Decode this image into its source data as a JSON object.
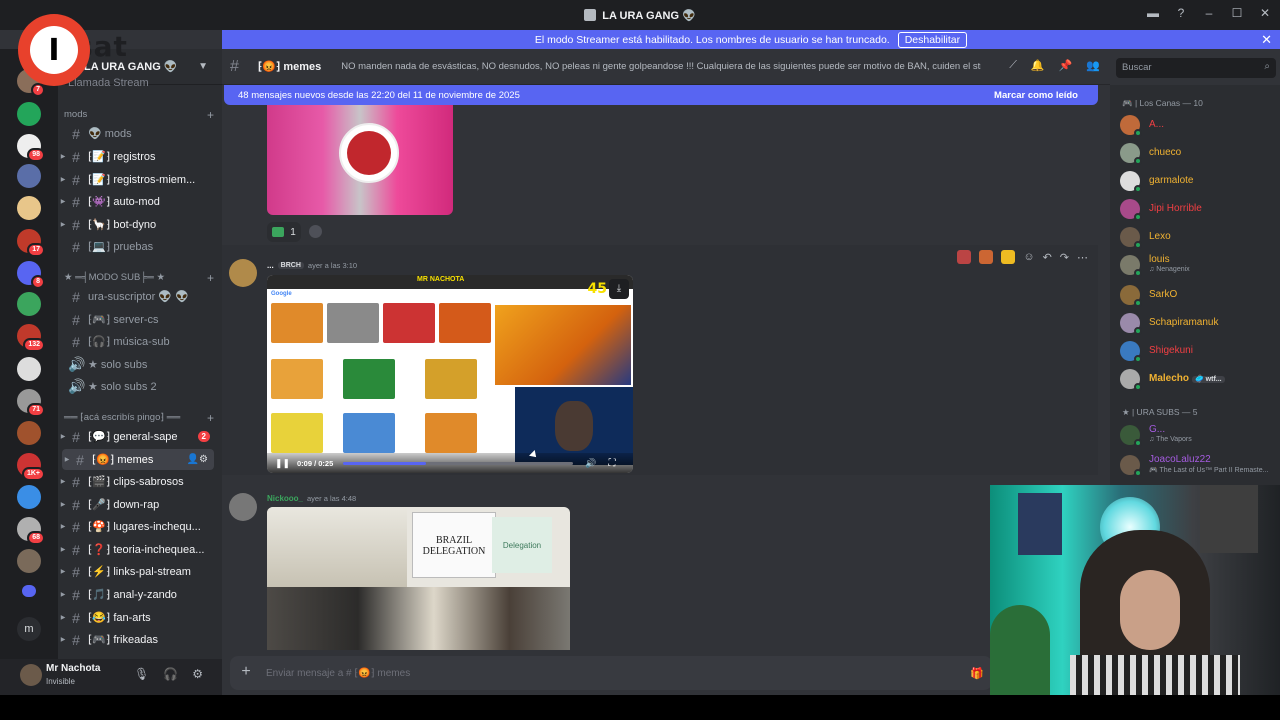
{
  "window": {
    "title": "LA URA GANG 👽",
    "controls": [
      "▬",
      "?",
      "–",
      "☐",
      "✕"
    ]
  },
  "streamer_bar": {
    "message": "El modo Streamer está habilitado. Los nombres de usuario se han truncado.",
    "button": "Deshabilitar",
    "close": "✕"
  },
  "logo": {
    "letter": "I",
    "text": "sat"
  },
  "server": {
    "name": "LA URA GANG 👽",
    "previous_item": "Llamada Stream"
  },
  "rail": {
    "badges": [
      "7",
      "98",
      "17",
      "8",
      "132",
      "71",
      "1K+",
      "68"
    ],
    "bottom_letter": "m"
  },
  "sidebar": {
    "categories": [
      {
        "label": "mods"
      },
      {
        "label": "★ ═╡MODO SUB╞═ ★"
      },
      {
        "label": "══ ⁅acá escribís pingo⁆ ══"
      }
    ],
    "channels": [
      {
        "label": "👽 mods",
        "icon": "hash"
      },
      {
        "label": "⁅📝⁆ registros",
        "icon": "hash"
      },
      {
        "label": "⁅📝⁆ registros-miem...",
        "icon": "hash"
      },
      {
        "label": "⁅👾⁆ auto-mod",
        "icon": "hash"
      },
      {
        "label": "⁅🦙⁆ bot-dyno",
        "icon": "hash"
      },
      {
        "label": "⁅💻⁆ pruebas",
        "icon": "hash"
      },
      {
        "label": "ura-suscriptor 👽 👽",
        "icon": "hash"
      },
      {
        "label": "⁅🎮⁆ server-cs",
        "icon": "hash"
      },
      {
        "label": "⁅🎧⁆ música-sub",
        "icon": "hash"
      },
      {
        "label": "★ solo subs",
        "icon": "speaker"
      },
      {
        "label": "★ solo subs 2",
        "icon": "speaker"
      },
      {
        "label": "⁅💬⁆ general-sape",
        "icon": "hash",
        "badge": "2"
      },
      {
        "label": "⁅😡⁆ memes",
        "icon": "hash"
      },
      {
        "label": "⁅🎬⁆ clips-sabrosos",
        "icon": "hash"
      },
      {
        "label": "⁅🎤⁆ down-rap",
        "icon": "hash"
      },
      {
        "label": "⁅🍄⁆ lugares-inchequ...",
        "icon": "hash"
      },
      {
        "label": "⁅❓⁆ teoria-inchequea...",
        "icon": "hash"
      },
      {
        "label": "⁅⚡⁆ links-pal-stream",
        "icon": "hash"
      },
      {
        "label": "⁅🎵⁆ anal-y-zando",
        "icon": "hash"
      },
      {
        "label": "⁅😂⁆ fan-arts",
        "icon": "hash"
      },
      {
        "label": "⁅🎮⁆ frikeadas",
        "icon": "hash"
      }
    ]
  },
  "user": {
    "name": "Mr Nachota",
    "status": "Invisible"
  },
  "chat": {
    "channel": "⁅😡⁆ memes",
    "topic": "NO manden nada de esvásticas, NO desnudos, NO peleas ni gente golpeandose !!! Cualquiera de las siguientes puede ser motivo de BAN, cuiden el stream!",
    "search_placeholder": "Buscar",
    "new_messages": "48 mensajes nuevos desde las 22:20 del 11 de noviembre de 2025",
    "mark_read": "Marcar como leído",
    "reaction_count": "1",
    "messages": [
      {
        "author": "...",
        "tag": "BRCH",
        "time": "ayer a las 3:10"
      },
      {
        "author": "Nickooo_",
        "time": "ayer a las 4:48"
      }
    ],
    "video": {
      "time": "0:09 / 0:25",
      "progress": 0.36,
      "overlay_banner": "MR NACHOTA",
      "score": "45"
    },
    "image_sign": "BRAZIL DELEGATION",
    "image_sign2": "Delegation",
    "composer_placeholder": "Enviar mensaje a # ⁅😡⁆ memes"
  },
  "members": {
    "groups": [
      {
        "label": "🎮 | Los Canas — 10"
      },
      {
        "label": "★ | URA SUBS — 5"
      }
    ],
    "list": [
      {
        "name": "A...",
        "color": "#f23f43"
      },
      {
        "name": "chueco",
        "color": "#f0b232"
      },
      {
        "name": "garmalote",
        "color": "#f0b232"
      },
      {
        "name": "Jipi Horrible",
        "color": "#f23f43"
      },
      {
        "name": "Lexo",
        "color": "#f0b232"
      },
      {
        "name": "louis",
        "color": "#f0b232",
        "sub": "♫ Nenagenix"
      },
      {
        "name": "SarkO",
        "color": "#f0b232"
      },
      {
        "name": "Schapiramanuk",
        "color": "#f0b232"
      },
      {
        "name": "Shigekuni",
        "color": "#f23f43"
      },
      {
        "name": "Malecho",
        "color": "#f0b232",
        "tag": "🥏 wtf..."
      },
      {
        "name": "G...",
        "color": "#a55ce0",
        "sub": "♫ The Vapors"
      },
      {
        "name": "JoacoLaluz22",
        "color": "#a55ce0",
        "sub": "🎮 The Last of Us™ Part II Remaste..."
      }
    ]
  }
}
